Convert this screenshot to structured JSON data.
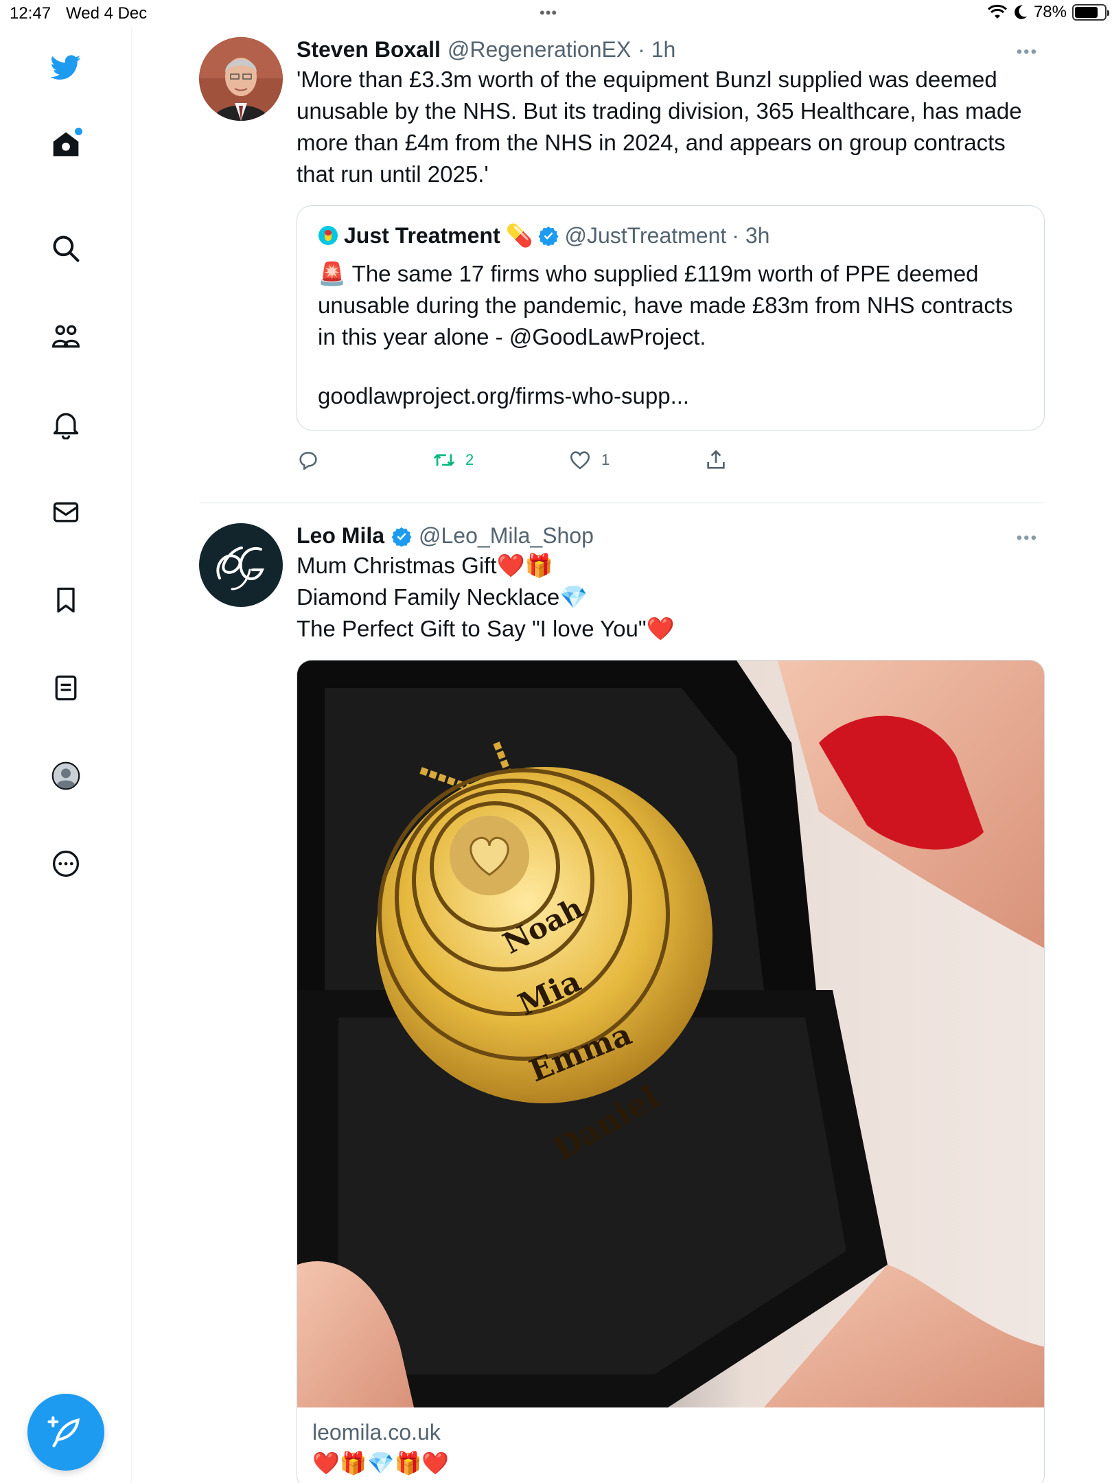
{
  "status_bar": {
    "time": "12:47",
    "date": "Wed 4 Dec",
    "battery": "78%",
    "battery_level": 0.78,
    "multitask_dots": "•••"
  },
  "sidebar": {
    "items": [
      {
        "name": "twitter-logo-icon"
      },
      {
        "name": "home-icon",
        "has_notification_dot": true
      },
      {
        "name": "search-icon"
      },
      {
        "name": "communities-icon"
      },
      {
        "name": "notifications-bell-icon"
      },
      {
        "name": "messages-envelope-icon"
      },
      {
        "name": "bookmarks-icon"
      },
      {
        "name": "lists-icon"
      },
      {
        "name": "profile-avatar-icon"
      },
      {
        "name": "more-options-icon"
      }
    ],
    "compose_button": {
      "icon": "compose-feather-icon"
    }
  },
  "colors": {
    "accent": "#1d9bf0",
    "retweet": "#00ba7c",
    "secondary_text": "#536471",
    "heart": "#e0245e"
  },
  "tweets": [
    {
      "author_name": "Steven Boxall",
      "handle": "@RegenerationEX",
      "time": "· 1h",
      "text": "'More than £3.3m worth of the equipment  Bunzl supplied was deemed unusable by the NHS. But its trading division,  365 Healthcare, has made more than £4m from the NHS in 2024, and  appears on group contracts that run until 2025.'",
      "quote": {
        "author_name": "Just Treatment",
        "author_emoji": "💊",
        "verified": true,
        "handle": "@JustTreatment",
        "time": "· 3h",
        "text_emoji": "🚨",
        "text": "The same 17 firms who supplied £119m worth of PPE deemed unusable during the pandemic, have made £83m from NHS contracts in this year alone  - @GoodLawProject.",
        "link": "goodlawproject.org/firms-who-supp..."
      },
      "actions": {
        "reply_count": "",
        "retweet_count": "2",
        "like_count": "1"
      }
    },
    {
      "author_name": "Leo Mila",
      "verified": true,
      "handle": "@Leo_Mila_Shop",
      "text_lines": [
        "Mum Christmas Gift❤️🎁",
        "Diamond Family Necklace💎",
        "The Perfect Gift to Say \"I love You\"❤️"
      ],
      "media": {
        "engraved_names": [
          "Noah",
          "Mia",
          "Emma",
          "Daniel"
        ]
      },
      "card": {
        "domain": "leomila.co.uk",
        "emojis": "❤️🎁💎🎁❤️"
      }
    }
  ]
}
